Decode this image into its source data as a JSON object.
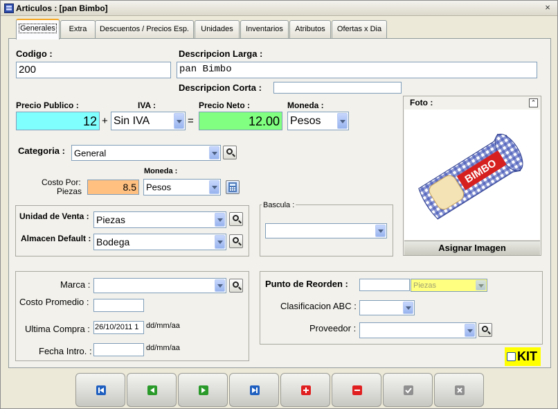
{
  "window": {
    "title": "Articulos : [pan Bimbo]",
    "close": "×"
  },
  "tabs": [
    "Generales",
    "Extra",
    "Descuentos / Precios Esp.",
    "Unidades",
    "Inventarios",
    "Atributos",
    "Ofertas x Dia"
  ],
  "codigo": {
    "label": "Codigo :",
    "value": "200"
  },
  "desc_larga": {
    "label": "Descripcion Larga :",
    "value": "pan Bimbo"
  },
  "desc_corta": {
    "label": "Descripcion Corta :",
    "value": ""
  },
  "precio_publico": {
    "label": "Precio Publico :",
    "value": "12",
    "color": "#80ffff"
  },
  "iva": {
    "label": "IVA :",
    "value": "Sin IVA"
  },
  "precio_neto": {
    "label": "Precio Neto :",
    "value": "12.00",
    "color": "#80ff80"
  },
  "moneda1": {
    "label": "Moneda :",
    "value": "Pesos"
  },
  "ops": {
    "plus": "+",
    "equals": "="
  },
  "categoria": {
    "label": "Categoria :",
    "value": "General"
  },
  "costo": {
    "label_line1": "Costo Por:",
    "label_line2": "Piezas",
    "value": "8.5",
    "color": "#ffc080"
  },
  "moneda2": {
    "label": "Moneda :",
    "value": "Pesos"
  },
  "unidad_venta": {
    "label": "Unidad de Venta :",
    "value": "Piezas"
  },
  "almacen": {
    "label": "Almacen Default :",
    "value": "Bodega"
  },
  "bascula": {
    "label": "Bascula :",
    "value": ""
  },
  "foto": {
    "label": "Foto :",
    "button": "Asignar Imagen",
    "collapse": "⌃",
    "image_text": "BIMBO"
  },
  "marca": {
    "label": "Marca :",
    "value": ""
  },
  "costo_promedio": {
    "label": "Costo Promedio :",
    "value": ""
  },
  "ultima_compra": {
    "label": "Ultima Compra :",
    "value": "26/10/2011 1",
    "format": "dd/mm/aa"
  },
  "fecha_intro": {
    "label": "Fecha Intro. :",
    "value": "",
    "format": "dd/mm/aa"
  },
  "reorden": {
    "label": "Punto de Reorden :",
    "value": "",
    "unit": "Piezas",
    "unit_color": "#ffff80"
  },
  "clasificacion": {
    "label": "Clasificacion ABC :",
    "value": ""
  },
  "proveedor": {
    "label": "Proveedor :",
    "value": ""
  },
  "kit": {
    "label": "KIT",
    "checked": false
  },
  "nav": [
    {
      "name": "first-record-button",
      "icon": "first-icon",
      "color": "#1f5fbf"
    },
    {
      "name": "previous-record-button",
      "icon": "previous-icon",
      "color": "#2a9a2a"
    },
    {
      "name": "next-record-button",
      "icon": "next-icon",
      "color": "#2a9a2a"
    },
    {
      "name": "last-record-button",
      "icon": "last-icon",
      "color": "#1f5fbf"
    },
    {
      "name": "add-record-button",
      "icon": "plus-icon",
      "color": "#e02020"
    },
    {
      "name": "delete-record-button",
      "icon": "minus-icon",
      "color": "#e02020"
    },
    {
      "name": "accept-button",
      "icon": "check-icon",
      "color": "#909090"
    },
    {
      "name": "cancel-button",
      "icon": "x-icon",
      "color": "#909090"
    }
  ]
}
